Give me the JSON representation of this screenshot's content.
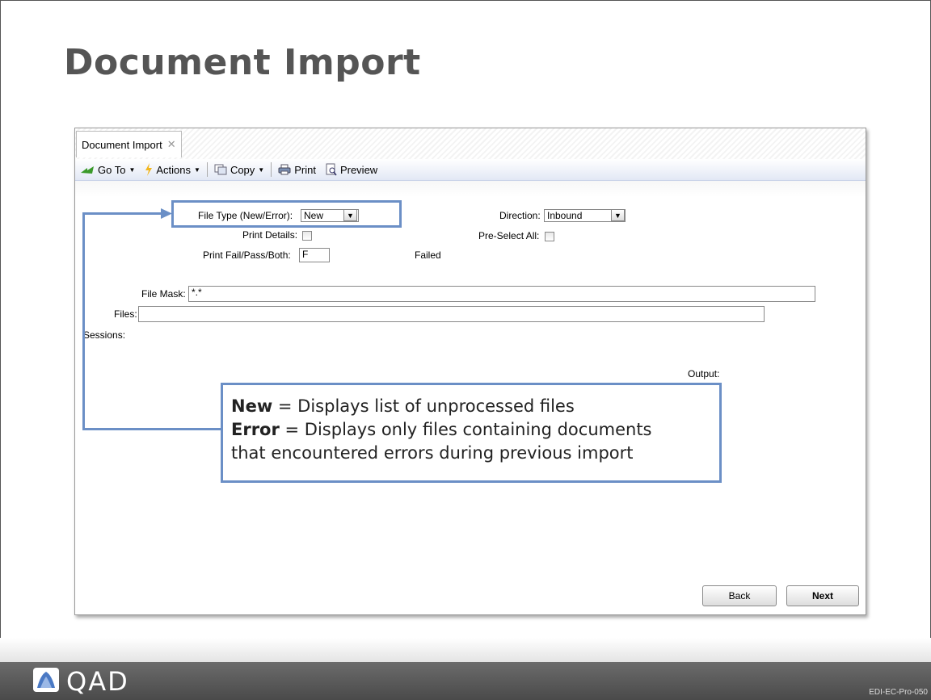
{
  "slide": {
    "title": "Document Import",
    "footer_logo": "QAD",
    "slide_code": "EDI-EC-Pro-050"
  },
  "window": {
    "tab_label": "Document Import",
    "toolbar": {
      "goto_label": "Go To",
      "actions_label": "Actions",
      "copy_label": "Copy",
      "print_label": "Print",
      "preview_label": "Preview"
    },
    "form": {
      "file_type_label": "File Type (New/Error):",
      "file_type_value": "New",
      "direction_label": "Direction:",
      "direction_value": "Inbound",
      "print_details_label": "Print Details:",
      "pre_select_label": "Pre-Select All:",
      "print_fail_label": "Print Fail/Pass/Both:",
      "print_fail_value": "F",
      "print_fail_desc": "Failed",
      "file_mask_label": "File Mask:",
      "file_mask_value": "*.*",
      "files_label": "Files:",
      "files_value": "",
      "sessions_label": "Sessions:",
      "output_label": "Output:"
    },
    "buttons": {
      "back": "Back",
      "next": "Next"
    }
  },
  "callout": {
    "new_term": "New",
    "new_desc": " = Displays list of unprocessed files",
    "error_term": "Error",
    "error_desc": " = Displays only files containing documents",
    "error_desc2": "that encountered errors during previous import"
  },
  "colors": {
    "accent": "#6b8fc6",
    "title": "#555555",
    "footer": "#5a5a5a"
  }
}
